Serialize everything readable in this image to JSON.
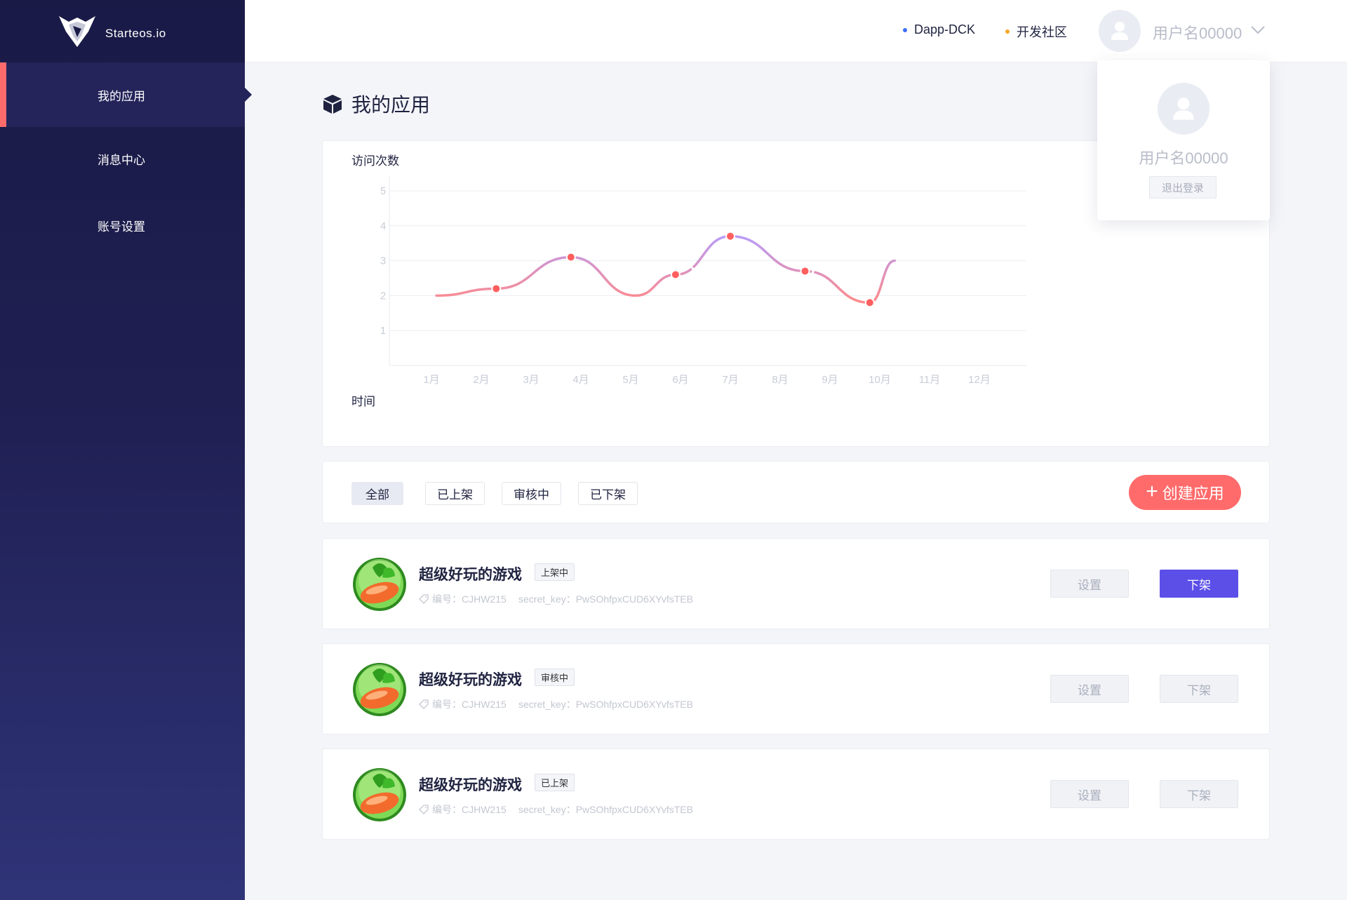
{
  "app": {
    "brand": "Starteos.io"
  },
  "sidebar": {
    "items": [
      {
        "label": "我的应用",
        "active": true
      },
      {
        "label": "消息中心",
        "active": false
      },
      {
        "label": "账号设置",
        "active": false
      }
    ]
  },
  "header": {
    "links": [
      {
        "label": "Dapp-DCK",
        "dot_color": "#3d6ff5"
      },
      {
        "label": "开发社区",
        "dot_color": "#f5a623"
      }
    ],
    "user_name": "用户名00000"
  },
  "page": {
    "title": "我的应用"
  },
  "chart_data": {
    "type": "line",
    "ylabel": "访问次数",
    "xlabel": "时间",
    "categories": [
      "1月",
      "2月",
      "3月",
      "4月",
      "5月",
      "6月",
      "7月",
      "8月",
      "9月",
      "10月",
      "11月",
      "12月"
    ],
    "yticks": [
      1,
      2,
      3,
      4,
      5
    ],
    "ylim": [
      0,
      5
    ],
    "grid": true,
    "series": [
      {
        "x": [
          0.1,
          1.3,
          2.8,
          4.1,
          4.9,
          6.0,
          7.5,
          8.8,
          9.3
        ],
        "values": [
          2.0,
          2.2,
          3.1,
          2.0,
          2.6,
          3.7,
          2.7,
          1.8,
          3.0
        ],
        "markers": [
          1.3,
          2.8,
          4.9,
          6.0,
          7.5,
          8.8
        ]
      }
    ]
  },
  "filters": {
    "tabs": [
      {
        "label": "全部",
        "active": true
      },
      {
        "label": "已上架",
        "active": false
      },
      {
        "label": "审核中",
        "active": false
      },
      {
        "label": "已下架",
        "active": false
      }
    ],
    "create_label": "创建应用"
  },
  "apps": [
    {
      "name": "超级好玩的游戏",
      "status": "上架中",
      "id_label": "编号：CJHW215",
      "key_label": "secret_key：PwSOhfpxCUD6XYvfsTEB",
      "settings_label": "设置",
      "off_label": "下架",
      "off_enabled": true
    },
    {
      "name": "超级好玩的游戏",
      "status": "审核中",
      "id_label": "编号：CJHW215",
      "key_label": "secret_key：PwSOhfpxCUD6XYvfsTEB",
      "settings_label": "设置",
      "off_label": "下架",
      "off_enabled": false
    },
    {
      "name": "超级好玩的游戏",
      "status": "已上架",
      "id_label": "编号：CJHW215",
      "key_label": "secret_key：PwSOhfpxCUD6XYvfsTEB",
      "settings_label": "设置",
      "off_label": "下架",
      "off_enabled": false
    }
  ],
  "user_menu": {
    "name": "用户名00000",
    "logout_label": "退出登录"
  },
  "colors": {
    "accent": "#ff6b6b",
    "primary": "#5b4fe8",
    "sidebar": "#1a1a47"
  },
  "icons": {
    "page_title": "cube-icon",
    "avatar": "user-icon",
    "meta": "tag-icon",
    "dropdown": "chevron-down-icon"
  }
}
